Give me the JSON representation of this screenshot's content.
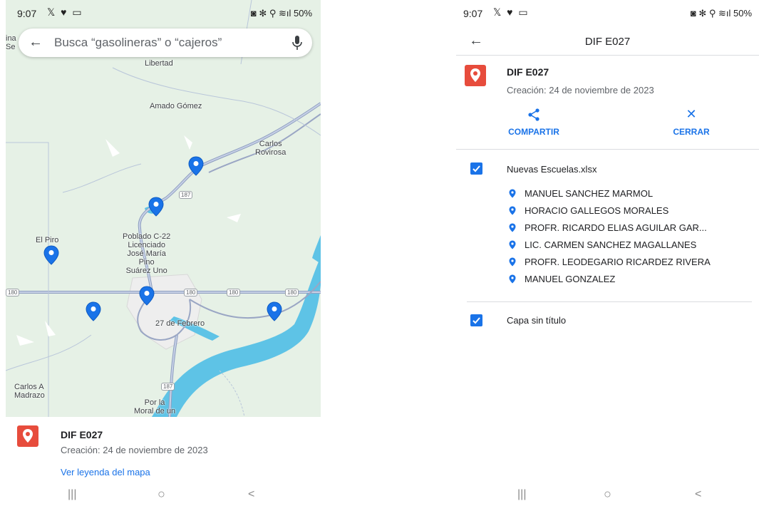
{
  "status_bar": {
    "time": "9:07",
    "left_icons": "𝕏 ♥ ▭",
    "right_text": "◙ ✻ ⚲ ≋ıl 50%"
  },
  "left": {
    "search": {
      "placeholder": "Busca “gasolineras” o “cajeros”"
    },
    "map_labels": {
      "libertad": "Libertad",
      "amado_gomez": "Amado Gómez",
      "carlos_rovirosa": "Carlos\nRovirosa",
      "el_piro": "El Piro",
      "poblado": "Poblado C-22\nLicenciado\nJosé María\nPino\nSuárez Uno",
      "feb27": "27 de Febrero",
      "carlos_madrazo": "Carlos A\nMadrazo",
      "por_la_moral": "Por la\nMoral de un",
      "edge_ina": "ina",
      "edge_se": "Se"
    },
    "road_shields": [
      "180",
      "180",
      "180",
      "180",
      "187",
      "187"
    ],
    "sheet": {
      "title": "DIF E027",
      "subtitle": "Creación: 24 de noviembre de 2023",
      "legend_link": "Ver leyenda del mapa"
    }
  },
  "right": {
    "header_title": "DIF E027",
    "map_name": "DIF E027",
    "created": "Creación: 24 de noviembre de 2023",
    "actions": {
      "share": "COMPARTIR",
      "close": "CERRAR"
    },
    "layers": [
      {
        "name": "Nuevas Escuelas.xlsx",
        "checked": true,
        "features": [
          "MANUEL SANCHEZ MARMOL",
          "HORACIO GALLEGOS MORALES",
          "PROFR. RICARDO ELIAS AGUILAR GAR...",
          "LIC. CARMEN SANCHEZ MAGALLANES",
          "PROFR. LEODEGARIO RICARDEZ RIVERA",
          "MANUEL GONZALEZ"
        ]
      },
      {
        "name": "Capa sin título",
        "checked": true,
        "features": []
      }
    ]
  },
  "navbar": {
    "recents": "|||",
    "home": "○",
    "back": "<"
  },
  "colors": {
    "accent": "#1a73e8",
    "brand_red": "#e74c3c",
    "map_green": "#e6f1e6",
    "water": "#5ec3e6",
    "pin": "#1a73e8"
  },
  "icons": [
    "back-arrow-icon",
    "mic-icon",
    "map-pin-icon",
    "share-icon",
    "close-icon",
    "checkbox-icon"
  ]
}
